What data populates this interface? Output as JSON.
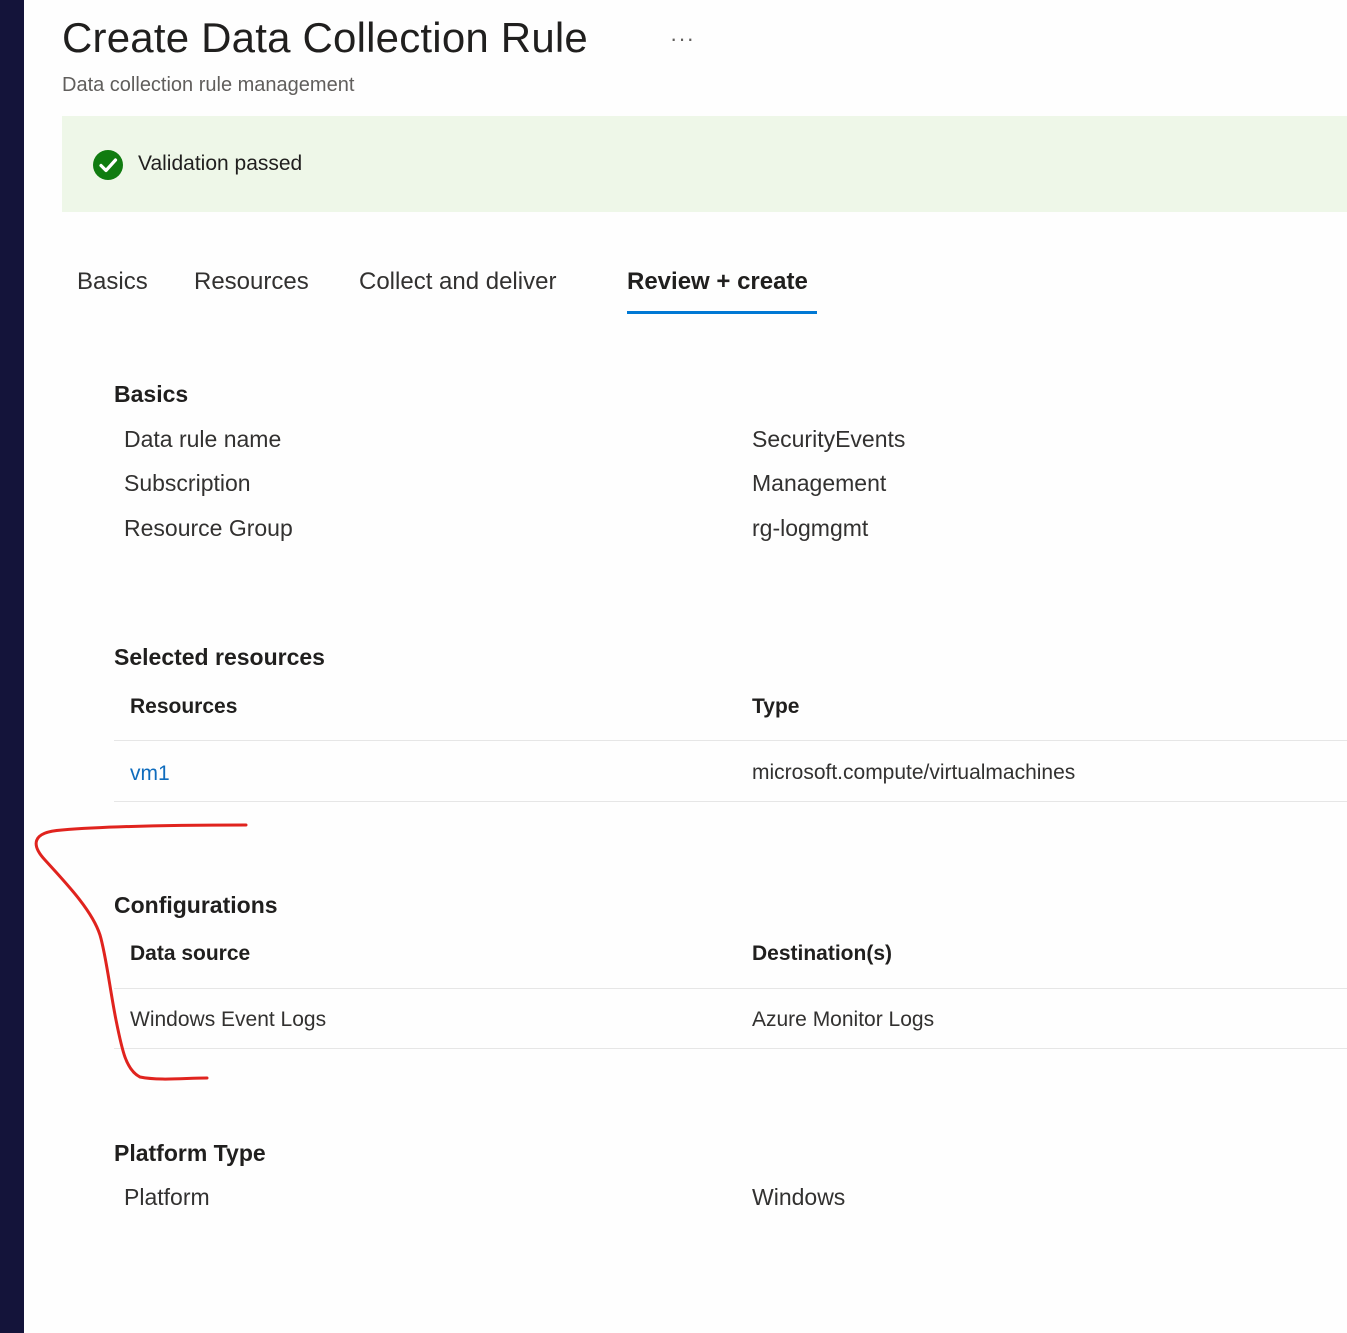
{
  "header": {
    "title": "Create Data Collection Rule",
    "more_label": "···",
    "subtitle": "Data collection rule management"
  },
  "banner": {
    "status_icon": "check-circle-icon",
    "text": "Validation passed",
    "color": "#107c10",
    "background": "#eef7e8"
  },
  "tabs": [
    {
      "label": "Basics"
    },
    {
      "label": "Resources"
    },
    {
      "label": "Collect and deliver"
    },
    {
      "label": "Review + create",
      "active": true
    }
  ],
  "basics": {
    "title": "Basics",
    "rows": [
      {
        "label": "Data rule name",
        "value": "SecurityEvents"
      },
      {
        "label": "Subscription",
        "value": "Management"
      },
      {
        "label": "Resource Group",
        "value": "rg-logmgmt"
      }
    ]
  },
  "selected_resources": {
    "title": "Selected resources",
    "headers": [
      "Resources",
      "Type"
    ],
    "rows": [
      {
        "resource": "vm1",
        "type": "microsoft.compute/virtualmachines"
      }
    ]
  },
  "configurations": {
    "title": "Configurations",
    "headers": [
      "Data source",
      "Destination(s)"
    ],
    "rows": [
      {
        "source": "Windows Event Logs",
        "destination": "Azure Monitor Logs"
      }
    ]
  },
  "platform": {
    "title": "Platform Type",
    "rows": [
      {
        "label": "Platform",
        "value": "Windows"
      }
    ]
  },
  "colors": {
    "accent": "#0078d4",
    "link": "#0f6cbd",
    "annotation": "#e0231e",
    "sidebar_edge": "#14143a"
  }
}
